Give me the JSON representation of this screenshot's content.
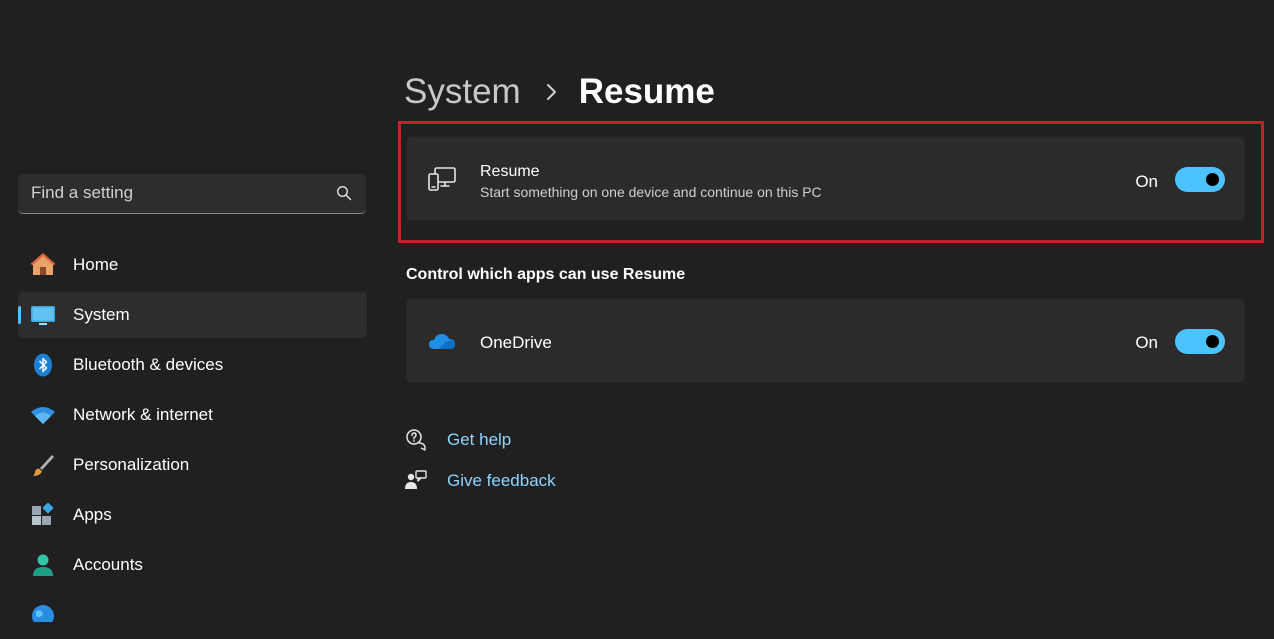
{
  "sidebar": {
    "search": {
      "placeholder": "Find a setting",
      "icon": "search-icon"
    },
    "items": [
      {
        "label": "Home",
        "icon": "home-icon",
        "active": false
      },
      {
        "label": "System",
        "icon": "monitor-icon",
        "active": true
      },
      {
        "label": "Bluetooth & devices",
        "icon": "bluetooth-icon",
        "active": false
      },
      {
        "label": "Network & internet",
        "icon": "wifi-icon",
        "active": false
      },
      {
        "label": "Personalization",
        "icon": "brush-icon",
        "active": false
      },
      {
        "label": "Apps",
        "icon": "apps-icon",
        "active": false
      },
      {
        "label": "Accounts",
        "icon": "person-icon",
        "active": false
      }
    ]
  },
  "breadcrumb": {
    "parent": "System",
    "current": "Resume"
  },
  "resume_card": {
    "title": "Resume",
    "description": "Start something on one device and continue on this PC",
    "state": "On",
    "toggle_on": true,
    "icon": "devices-icon"
  },
  "apps_section": {
    "heading": "Control which apps can use Resume",
    "items": [
      {
        "title": "OneDrive",
        "state": "On",
        "toggle_on": true,
        "icon": "onedrive-icon"
      }
    ]
  },
  "links": {
    "help": "Get help",
    "feedback": "Give feedback"
  },
  "colors": {
    "accent": "#4cc2ff",
    "highlight_border": "#c4222b",
    "background": "#202020",
    "card": "#2b2b2b"
  }
}
